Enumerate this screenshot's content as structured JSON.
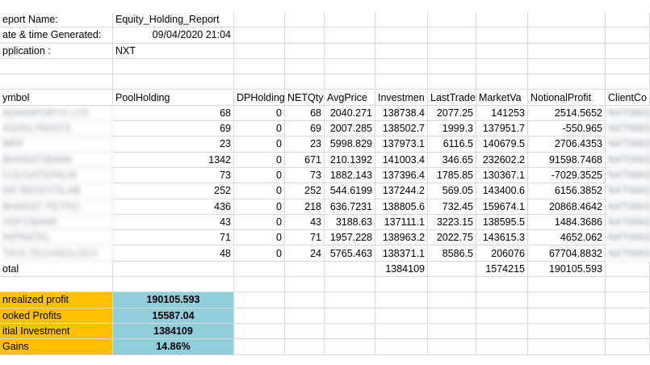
{
  "meta": {
    "report_name_label": "eport Name:",
    "report_name_value": "Equity_Holding_Report",
    "generated_label": "ate & time Generated:",
    "generated_value": "09/04/2020 21:04",
    "application_label": "pplication :",
    "application_value": "NXT"
  },
  "headers": [
    "ymbol",
    "PoolHolding",
    "DPHolding",
    "NETQty",
    "AvgPrice",
    "Investmen",
    "LastTrade",
    "MarketVa",
    "NotionalProfit",
    "ClientCo"
  ],
  "rows": [
    {
      "symbol": "ADANIPORTS LTD",
      "pool": "68",
      "dp": "0",
      "net": "68",
      "avg": "2040.271",
      "inv": "138738.4",
      "last": "2077.25",
      "mv": "141253",
      "np": "2514.5652",
      "cc": "NXT0001234"
    },
    {
      "symbol": "ASIAN PAINTS",
      "pool": "69",
      "dp": "0",
      "net": "69",
      "avg": "2007.285",
      "inv": "138502.7",
      "last": "1999.3",
      "mv": "137951.7",
      "np": "-550.965",
      "cc": "NXT0001234"
    },
    {
      "symbol": "MRF",
      "pool": "23",
      "dp": "0",
      "net": "23",
      "avg": "5998.829",
      "inv": "137973.1",
      "last": "6116.5",
      "mv": "140679.5",
      "np": "2706.4353",
      "cc": "NXT0001234"
    },
    {
      "symbol": "BHARATIBANK",
      "pool": "1342",
      "dp": "0",
      "net": "671",
      "avg": "210.1392",
      "inv": "141003.4",
      "last": "346.65",
      "mv": "232602.2",
      "np": "91598.7468",
      "cc": "NXT0001234"
    },
    {
      "symbol": "COLGATEPALM",
      "pool": "73",
      "dp": "0",
      "net": "73",
      "avg": "1882.143",
      "inv": "137396.4",
      "last": "1785.85",
      "mv": "130367.1",
      "np": "-7029.3525",
      "cc": "NXT0001234"
    },
    {
      "symbol": "DR REDDYSLAB",
      "pool": "252",
      "dp": "0",
      "net": "252",
      "avg": "544.6199",
      "inv": "137244.2",
      "last": "569.05",
      "mv": "143400.6",
      "np": "6156.3852",
      "cc": "NXT0001234"
    },
    {
      "symbol": "BHARAT PETRO",
      "pool": "436",
      "dp": "0",
      "net": "218",
      "avg": "636.7231",
      "inv": "138805.6",
      "last": "732.45",
      "mv": "159674.1",
      "np": "20868.4642",
      "cc": "NXT0001234"
    },
    {
      "symbol": "HDFCBANK",
      "pool": "43",
      "dp": "0",
      "net": "43",
      "avg": "3188.63",
      "inv": "137111.1",
      "last": "3223.15",
      "mv": "138595.5",
      "np": "1484.3686",
      "cc": "NXT0001234"
    },
    {
      "symbol": "INFRATEL",
      "pool": "71",
      "dp": "0",
      "net": "71",
      "avg": "1957.228",
      "inv": "138963.2",
      "last": "2022.75",
      "mv": "143615.3",
      "np": "4652.062",
      "cc": "NXT0001234"
    },
    {
      "symbol": "TATA TECHNOLOGY",
      "pool": "48",
      "dp": "0",
      "net": "24",
      "avg": "5765.463",
      "inv": "138371.1",
      "last": "8586.5",
      "mv": "206076",
      "np": "67704.8832",
      "cc": "NXT0001234"
    }
  ],
  "total": {
    "label": "otal",
    "inv": "1384109",
    "mv": "1574215",
    "np": "190105.593"
  },
  "summary": [
    {
      "label": "nrealized profit",
      "value": "190105.593"
    },
    {
      "label": "ooked Profits",
      "value": "15587.04"
    },
    {
      "label": "itial Investment",
      "value": "1384109"
    },
    {
      "label": " Gains",
      "value": "14.86%"
    }
  ],
  "colors": {
    "summary_label_bg": "#ffc000",
    "summary_value_bg": "#92cddc",
    "gridline": "#d9d9d9"
  }
}
